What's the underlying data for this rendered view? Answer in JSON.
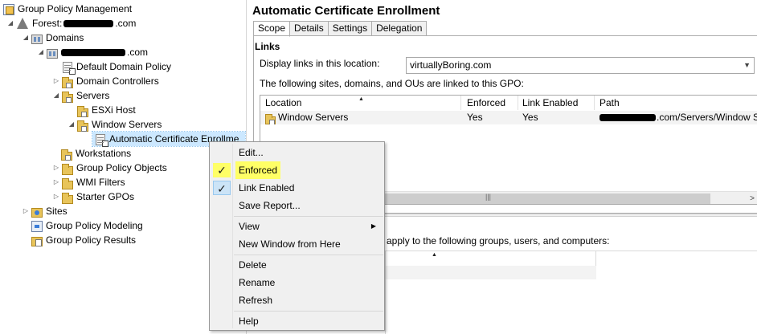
{
  "tree": {
    "root_label": "Group Policy Management",
    "forest_prefix": "Forest: ",
    "forest_suffix": ".com",
    "domains_label": "Domains",
    "domain_suffix": ".com",
    "default_domain_policy": "Default Domain Policy",
    "domain_controllers": "Domain Controllers",
    "servers": "Servers",
    "esxi_host": "ESXi Host",
    "window_servers": "Window Servers",
    "auto_cert_link": "Automatic Certificate Enrollme",
    "workstations": "Workstations",
    "gpo_objects": "Group Policy Objects",
    "wmi_filters": "WMI Filters",
    "starter_gpos": "Starter GPOs",
    "sites": "Sites",
    "modeling": "Group Policy Modeling",
    "results": "Group Policy Results"
  },
  "right": {
    "title": "Automatic Certificate Enrollment",
    "tabs": [
      "Scope",
      "Details",
      "Settings",
      "Delegation"
    ],
    "links_heading": "Links",
    "display_label": "Display links in this location:",
    "location_value": "virtuallyBoring.com",
    "linked_label": "The following sites, domains, and OUs are linked to this GPO:",
    "columns": [
      "Location",
      "Enforced",
      "Link Enabled",
      "Path"
    ],
    "row": {
      "location": "Window Servers",
      "enforced": "Yes",
      "link_enabled": "Yes",
      "path_suffix": ".com/Servers/Window Ser"
    },
    "filter_label": "apply to the following groups, users, and computers:"
  },
  "menu": {
    "items": [
      "Edit...",
      "Enforced",
      "Link Enabled",
      "Save Report...",
      "View",
      "New Window from Here",
      "Delete",
      "Rename",
      "Refresh",
      "Help"
    ],
    "check": "✓",
    "submenu_arrow": "▶"
  },
  "colors": {
    "highlight": "#ffff66",
    "check_blue": "#cce4f7",
    "selection": "#cce8ff"
  }
}
